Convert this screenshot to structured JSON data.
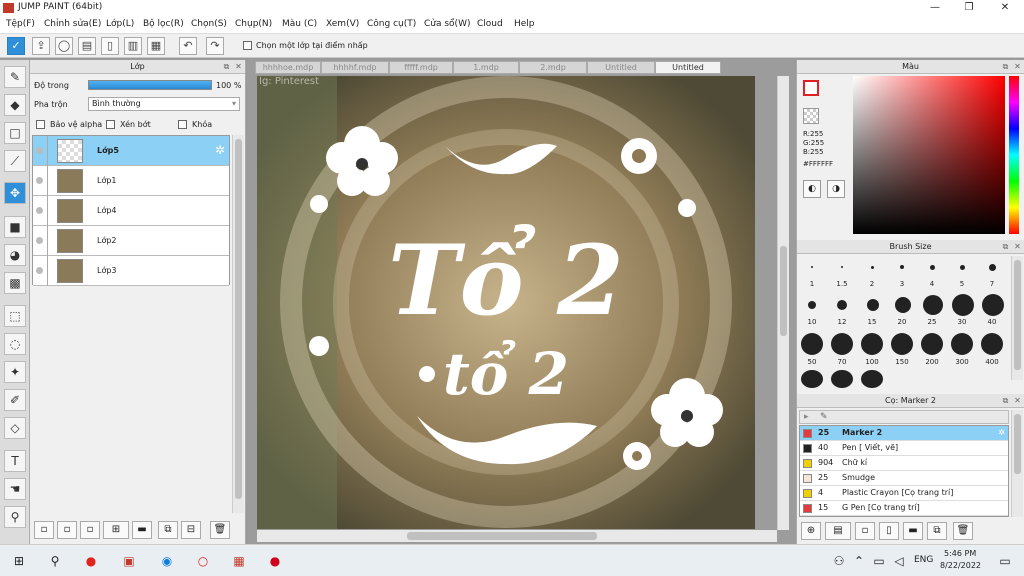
{
  "window": {
    "title": "JUMP PAINT (64bit)",
    "minimize": "—",
    "maximize": "❐",
    "close": "✕"
  },
  "menu": [
    "Tệp(F)",
    "Chỉnh sửa(E)",
    "Lớp(L)",
    "Bộ lọc(R)",
    "Chọn(S)",
    "Chụp(N)",
    "Màu (C)",
    "Xem(V)",
    "Công cụ(T)",
    "Cửa sổ(W)",
    "Cloud",
    "Help"
  ],
  "toolbar": {
    "pick_layer_label": "Chọn một lớp tại điểm nhấp"
  },
  "layer_panel": {
    "title": "Lớp",
    "opacity_label": "Độ trong",
    "opacity_value": "100 %",
    "opacity_fraction": 1.0,
    "blend_label": "Pha trộn",
    "blend_value": "Bình thường",
    "protect_alpha": "Bảo vệ alpha",
    "clipping": "Xén bớt",
    "lock": "Khóa",
    "layers": [
      {
        "name": "Lớp5",
        "selected": true
      },
      {
        "name": "Lớp1",
        "selected": false
      },
      {
        "name": "Lớp4",
        "selected": false
      },
      {
        "name": "Lớp2",
        "selected": false
      },
      {
        "name": "Lớp3",
        "selected": false
      }
    ]
  },
  "canvas": {
    "tabs": [
      "hhhhoe.mdp",
      "hhhhf.mdp",
      "fffff.mdp",
      "1.mdp",
      "2.mdp",
      "Untitled",
      "Untitled"
    ],
    "active_tab": 6,
    "watermark": "Ig: Pinterest",
    "art_text_main": "Tổ 2",
    "art_text_sub": "tổ 2"
  },
  "color_panel": {
    "title": "Màu",
    "r": "R:255",
    "g": "G:255",
    "b": "B:255",
    "hex": "#FFFFFF"
  },
  "brush_size_panel": {
    "title": "Brush Size",
    "sizes": [
      "1",
      "1.5",
      "2",
      "3",
      "4",
      "5",
      "7",
      "10",
      "12",
      "15",
      "20",
      "25",
      "30",
      "40",
      "50",
      "70",
      "100",
      "150",
      "200",
      "300",
      "400"
    ]
  },
  "brush_panel": {
    "title": "Cọ: Marker 2",
    "brushes": [
      {
        "size": "25",
        "name": "Marker 2",
        "color": "#e83a3a",
        "selected": true
      },
      {
        "size": "40",
        "name": "Pen [ Viết, vẽ]",
        "color": "#222222",
        "selected": false
      },
      {
        "size": "904",
        "name": "Chữ kí",
        "color": "#f0d000",
        "selected": false
      },
      {
        "size": "25",
        "name": "Smudge",
        "color": "#f5e6d8",
        "selected": false
      },
      {
        "size": "4",
        "name": "Plastic Crayon [Cọ trang trí]",
        "color": "#f0d000",
        "selected": false
      },
      {
        "size": "15",
        "name": "G Pen [Cọ trang trí]",
        "color": "#e83a3a",
        "selected": false
      }
    ]
  },
  "taskbar": {
    "lang": "ENG",
    "time": "5:46 PM",
    "date": "8/22/2022"
  }
}
